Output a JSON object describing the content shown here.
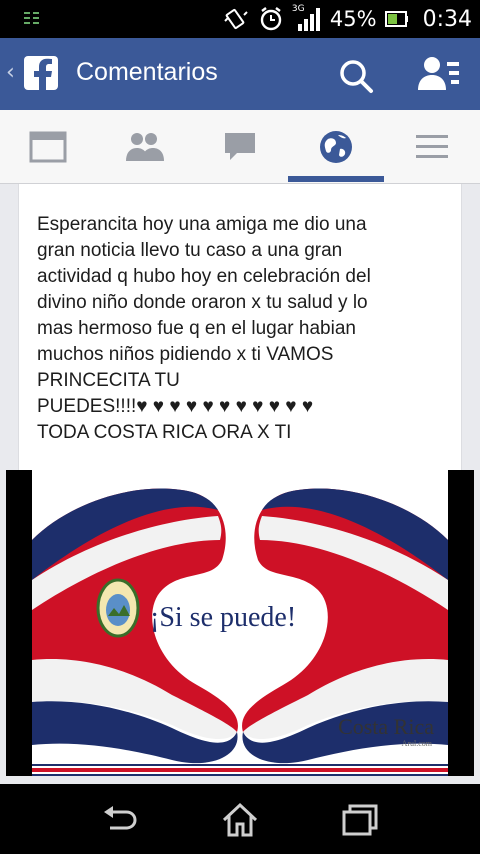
{
  "status_bar": {
    "network": "3G",
    "battery_percent": "45%",
    "time": "0:34",
    "icons": [
      "data-icon",
      "vibrate-icon",
      "alarm-icon",
      "signal-icon",
      "battery-icon"
    ]
  },
  "app_bar": {
    "title": "Comentarios",
    "icons": [
      "back-icon",
      "facebook-logo",
      "search-icon",
      "friends-icon"
    ]
  },
  "tabs": [
    {
      "name": "news-feed",
      "icon": "news-feed-icon",
      "active": false
    },
    {
      "name": "friends",
      "icon": "friends-icon",
      "active": false
    },
    {
      "name": "messages",
      "icon": "chat-icon",
      "active": false
    },
    {
      "name": "notifications",
      "icon": "globe-icon",
      "active": true
    },
    {
      "name": "more",
      "icon": "menu-icon",
      "active": false
    }
  ],
  "post": {
    "text": "Esperancita hoy una amiga me dio una\ngran noticia llevo tu caso a una gran\nactividad q hubo hoy en celebración del\ndivino niño donde oraron x tu salud y lo\nmas hermoso fue q en el lugar habian\nmuchos niños pidiendo x ti VAMOS\nPRINCECITA TU\nPUEDES!!!!♥ ♥ ♥ ♥ ♥ ♥ ♥ ♥ ♥ ♥ ♥\nTODA COSTA RICA ORA X TI"
  },
  "photo": {
    "caption": "¡Si se puede!",
    "brand": "Costa Rica",
    "brand_sub": "Arul.com"
  },
  "nav_bar": {
    "icons": [
      "back-icon",
      "home-icon",
      "recent-apps-icon"
    ]
  },
  "colors": {
    "facebook_blue": "#3b5998",
    "flag_blue": "#1d2e6b",
    "flag_red": "#ce1126"
  }
}
